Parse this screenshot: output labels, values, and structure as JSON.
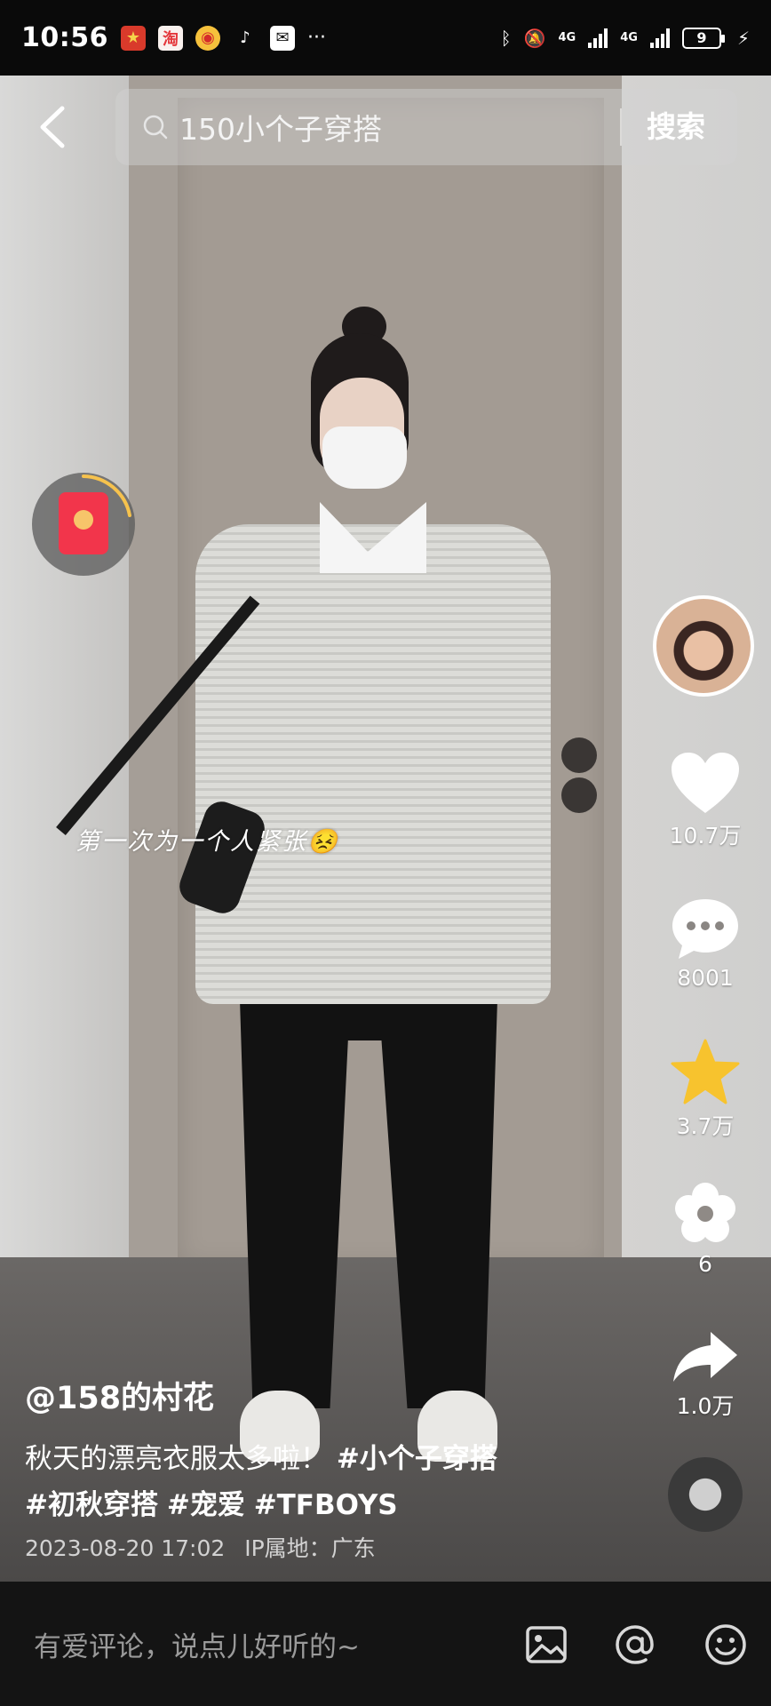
{
  "status_bar": {
    "time": "10:56",
    "more": "···",
    "network_1": "4G",
    "network_2": "4G",
    "battery": "9"
  },
  "search": {
    "query": "150小个子穿搭",
    "button_label": "搜索"
  },
  "video": {
    "overlay_caption": "第一次为一个人紧张😣"
  },
  "rail": {
    "likes": "10.7万",
    "comments": "8001",
    "favorites": "3.7万",
    "flower": "6",
    "shares": "1.0万"
  },
  "post": {
    "author": "@158的村花",
    "text": "秋天的漂亮衣服太多啦！",
    "tags_line1": "#小个子穿搭",
    "tag_1": "#初秋穿搭",
    "tag_2": "#宠爱",
    "tag_3": "#TFBOYS",
    "date": "2023-08-20 17:02",
    "ip_label": "IP属地：广东"
  },
  "comment_bar": {
    "placeholder": "有爱评论，说点儿好听的~"
  },
  "icons": {
    "back": "back-arrow-icon",
    "search": "search-icon",
    "like": "heart-icon",
    "comment": "comment-icon",
    "favorite": "star-icon",
    "flower": "flower-icon",
    "share": "share-icon",
    "image": "image-icon",
    "mention": "at-icon",
    "emoji": "emoji-icon"
  },
  "colors": {
    "star": "#f7c32e",
    "red_packet": "#f2354b",
    "statusbar_bg": "#0a0a0a",
    "comment_bar_bg": "#141414"
  }
}
